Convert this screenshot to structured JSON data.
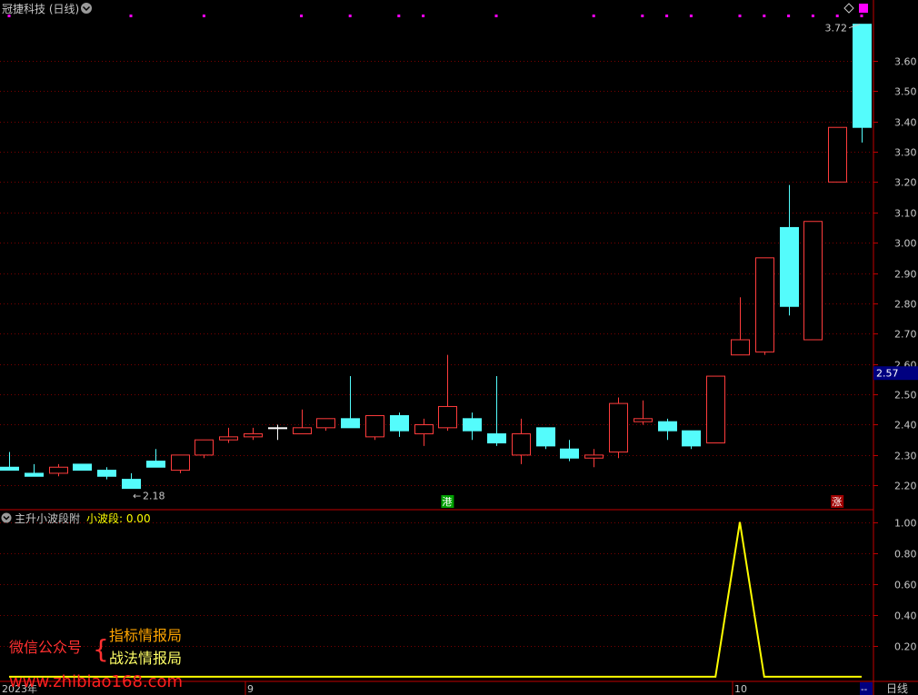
{
  "window": {
    "stock_title": "冠捷科技 (日线)",
    "indicator_title": "主升小波段附",
    "indicator_value_label": "小波段: 0.00",
    "period_label": "日线",
    "bottom_right_marker": "--"
  },
  "colors": {
    "background": "#000000",
    "up": "#ff3c3c",
    "down": "#54fcfc",
    "neutral": "#ffffff",
    "grid": "#7a0000",
    "axis": "#c00000",
    "axis_text": "#c8c8c8",
    "magenta": "#ff00ff",
    "indicator_line": "#ffff00",
    "current_price_box": "#000080"
  },
  "chart_data": [
    {
      "type": "candlestick",
      "title": "冠捷科技 (日线)",
      "ylim": [
        2.12,
        3.74
      ],
      "y_ticks": [
        2.2,
        2.3,
        2.4,
        2.5,
        2.6,
        2.7,
        2.8,
        2.9,
        3.0,
        3.1,
        3.2,
        3.3,
        3.4,
        3.5,
        3.6
      ],
      "y_tick_labels": [
        "2.20",
        "2.30",
        "2.40",
        "2.50",
        "2.60",
        "2.70",
        "2.80",
        "2.90",
        "3.00",
        "3.10",
        "3.20",
        "3.30",
        "3.40",
        "3.50",
        "3.60"
      ],
      "current_price": 2.57,
      "current_price_label": "2.57",
      "max_label": "3.72",
      "min_label": "2.18",
      "x_labels": [
        {
          "index": 0,
          "text": "2023年"
        },
        {
          "index": 10,
          "text": "9"
        },
        {
          "index": 30,
          "text": "10"
        }
      ],
      "candles": [
        {
          "o": 2.26,
          "h": 2.31,
          "l": 2.25,
          "c": 2.25
        },
        {
          "o": 2.24,
          "h": 2.27,
          "l": 2.23,
          "c": 2.23
        },
        {
          "o": 2.24,
          "h": 2.27,
          "l": 2.23,
          "c": 2.26
        },
        {
          "o": 2.27,
          "h": 2.27,
          "l": 2.25,
          "c": 2.25
        },
        {
          "o": 2.25,
          "h": 2.26,
          "l": 2.22,
          "c": 2.23
        },
        {
          "o": 2.22,
          "h": 2.24,
          "l": 2.19,
          "c": 2.19
        },
        {
          "o": 2.28,
          "h": 2.32,
          "l": 2.26,
          "c": 2.26
        },
        {
          "o": 2.25,
          "h": 2.3,
          "l": 2.24,
          "c": 2.3
        },
        {
          "o": 2.3,
          "h": 2.35,
          "l": 2.29,
          "c": 2.35
        },
        {
          "o": 2.35,
          "h": 2.39,
          "l": 2.34,
          "c": 2.36
        },
        {
          "o": 2.36,
          "h": 2.39,
          "l": 2.35,
          "c": 2.37
        },
        {
          "o": 2.39,
          "h": 2.4,
          "l": 2.35,
          "c": 2.39
        },
        {
          "o": 2.37,
          "h": 2.45,
          "l": 2.37,
          "c": 2.39
        },
        {
          "o": 2.39,
          "h": 2.42,
          "l": 2.38,
          "c": 2.42
        },
        {
          "o": 2.42,
          "h": 2.56,
          "l": 2.39,
          "c": 2.39
        },
        {
          "o": 2.36,
          "h": 2.43,
          "l": 2.35,
          "c": 2.43
        },
        {
          "o": 2.43,
          "h": 2.44,
          "l": 2.36,
          "c": 2.38
        },
        {
          "o": 2.37,
          "h": 2.42,
          "l": 2.33,
          "c": 2.4
        },
        {
          "o": 2.39,
          "h": 2.63,
          "l": 2.38,
          "c": 2.46
        },
        {
          "o": 2.42,
          "h": 2.44,
          "l": 2.35,
          "c": 2.38
        },
        {
          "o": 2.37,
          "h": 2.56,
          "l": 2.33,
          "c": 2.34
        },
        {
          "o": 2.3,
          "h": 2.42,
          "l": 2.27,
          "c": 2.37
        },
        {
          "o": 2.39,
          "h": 2.39,
          "l": 2.32,
          "c": 2.33
        },
        {
          "o": 2.32,
          "h": 2.35,
          "l": 2.28,
          "c": 2.29
        },
        {
          "o": 2.29,
          "h": 2.32,
          "l": 2.26,
          "c": 2.3
        },
        {
          "o": 2.31,
          "h": 2.49,
          "l": 2.29,
          "c": 2.47
        },
        {
          "o": 2.41,
          "h": 2.48,
          "l": 2.4,
          "c": 2.42
        },
        {
          "o": 2.41,
          "h": 2.42,
          "l": 2.35,
          "c": 2.38
        },
        {
          "o": 2.38,
          "h": 2.38,
          "l": 2.32,
          "c": 2.33
        },
        {
          "o": 2.34,
          "h": 2.56,
          "l": 2.34,
          "c": 2.56
        },
        {
          "o": 2.63,
          "h": 2.82,
          "l": 2.63,
          "c": 2.68
        },
        {
          "o": 2.64,
          "h": 2.95,
          "l": 2.63,
          "c": 2.95
        },
        {
          "o": 3.05,
          "h": 3.19,
          "l": 2.76,
          "c": 2.79
        },
        {
          "o": 2.68,
          "h": 3.07,
          "l": 2.68,
          "c": 3.07
        },
        {
          "o": 3.2,
          "h": 3.38,
          "l": 3.2,
          "c": 3.38
        },
        {
          "o": 3.72,
          "h": 3.72,
          "l": 3.33,
          "c": 3.38
        }
      ],
      "markers": [
        {
          "index": 18,
          "text": "港",
          "color": "#00a000"
        },
        {
          "index": 34,
          "text": "涨",
          "color": "#a00000"
        }
      ],
      "top_dot_indices": [
        0,
        5,
        8,
        12,
        14,
        16,
        17,
        20,
        24,
        26,
        27,
        28,
        30,
        31,
        32,
        33,
        34,
        35
      ]
    },
    {
      "type": "line",
      "title": "主升小波段附",
      "series": [
        {
          "name": "小波段",
          "values": [
            0,
            0,
            0,
            0,
            0,
            0,
            0,
            0,
            0,
            0,
            0,
            0,
            0,
            0,
            0,
            0,
            0,
            0,
            0,
            0,
            0,
            0,
            0,
            0,
            0,
            0,
            0,
            0,
            0,
            0,
            1,
            0,
            0,
            0,
            0,
            0
          ]
        }
      ],
      "ylim": [
        -0.03,
        1.08
      ],
      "y_ticks": [
        0.2,
        0.4,
        0.6,
        0.8,
        1.0
      ],
      "y_tick_labels": [
        "0.20",
        "0.40",
        "0.60",
        "0.80",
        "1.00"
      ]
    }
  ],
  "watermark": {
    "label": "微信公众号",
    "line1": "指标情报局",
    "line2": "战法情报局",
    "url": "www.zhibiao168.com"
  }
}
